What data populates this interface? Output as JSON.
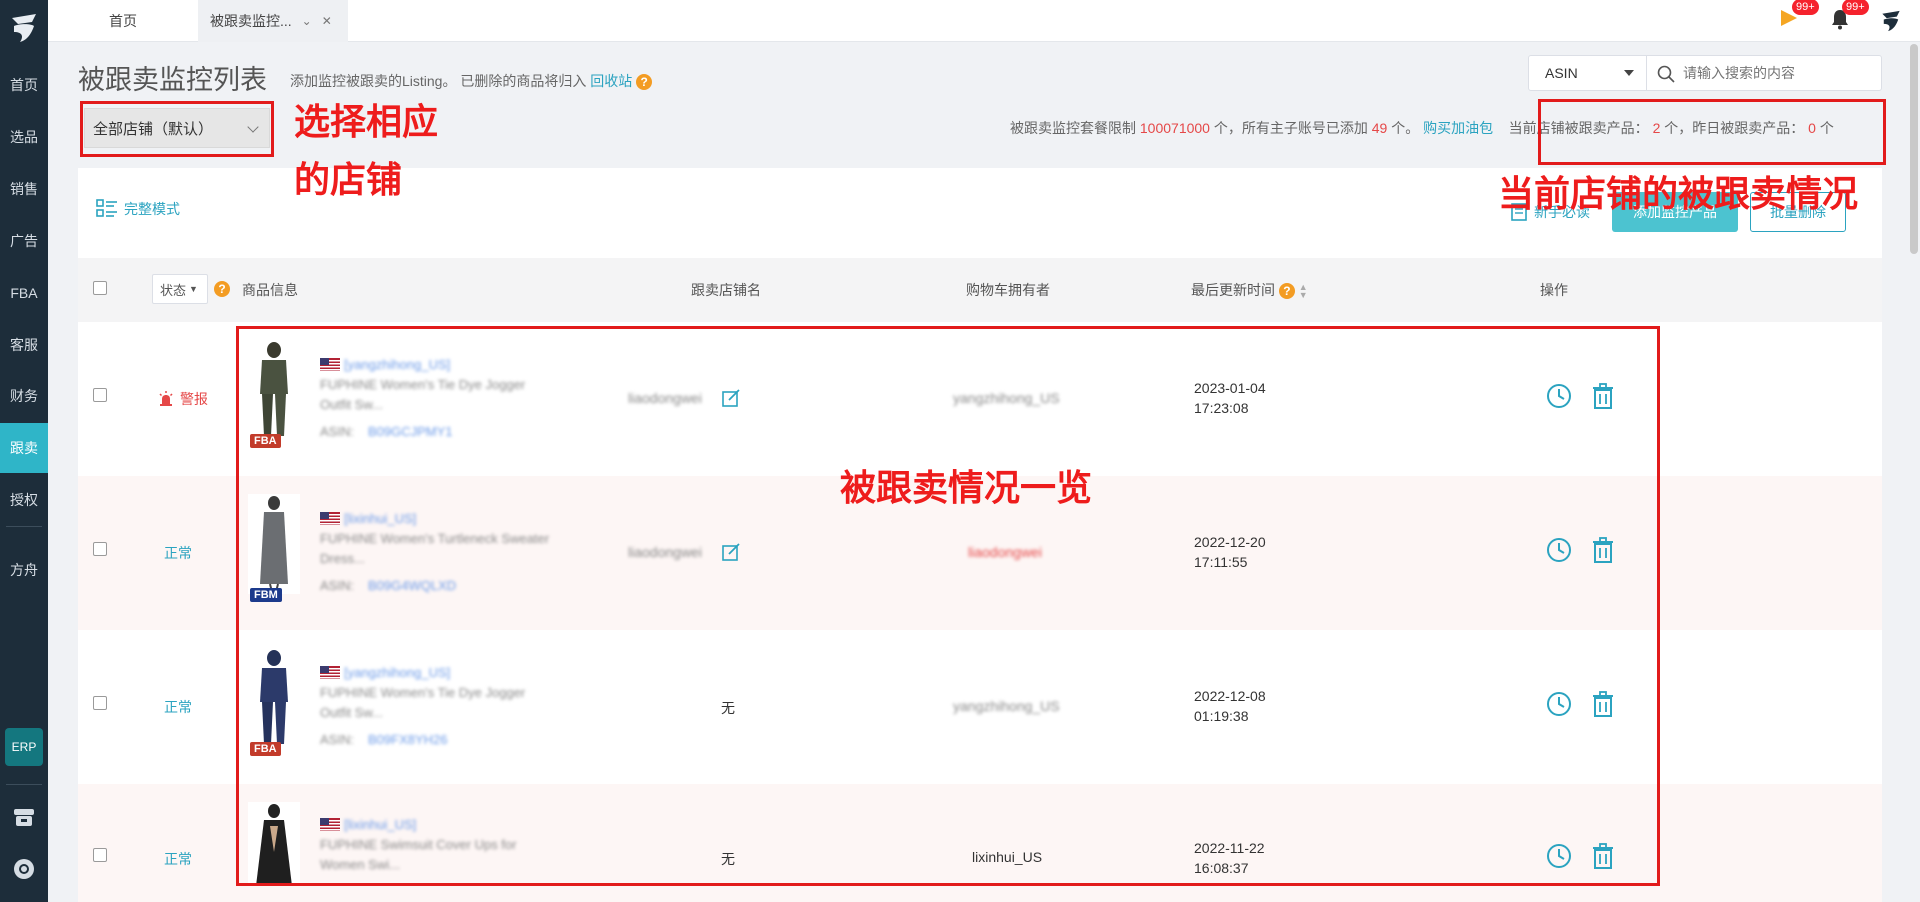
{
  "sidebar": {
    "items": [
      {
        "label": "首页"
      },
      {
        "label": "选品"
      },
      {
        "label": "销售"
      },
      {
        "label": "广告"
      },
      {
        "label": "FBA"
      },
      {
        "label": "客服"
      },
      {
        "label": "财务"
      },
      {
        "label": "跟卖"
      },
      {
        "label": "授权"
      },
      {
        "label": "方舟"
      }
    ],
    "erp_label": "ERP",
    "active_color": "#2fb5c8"
  },
  "topbar": {
    "tab_home": "首页",
    "tab_active": "被跟卖监控...",
    "badge_flag": "99+",
    "badge_bell": "99+"
  },
  "header": {
    "title": "被跟卖监控列表",
    "subtitle": "添加监控被跟卖的Listing。 已删除的商品将归入",
    "recycle_link": "回收站",
    "search_type": "ASIN",
    "search_placeholder": "请输入搜索的内容",
    "store_select": "全部店铺（默认）",
    "quota_prefix": "被跟卖监控套餐限制",
    "quota_limit": "100071000",
    "quota_mid": "个，所有主子账号已添加",
    "quota_added": "49",
    "quota_suffix": "个。",
    "buy_link": "购买加油包",
    "current_label": "当前店铺被跟卖产品：",
    "current_count": "2",
    "yesterday_label": "个，昨日被跟卖产品：",
    "yesterday_count": "0",
    "unit": "个"
  },
  "toolbar": {
    "mode": "完整模式",
    "guide": "新手必读",
    "add": "添加监控产品",
    "batch_delete": "批量删除"
  },
  "table": {
    "headers": {
      "status": "状态",
      "product": "商品信息",
      "seller": "跟卖店铺名",
      "buybox": "购物车拥有者",
      "updated": "最后更新时间",
      "actions": "操作"
    },
    "rows": [
      {
        "status": "警报",
        "account": "[yangzhihong_US]",
        "title1": "FUPHINE Women's Tie Dye Jogger",
        "title2": "Outfit Sw...",
        "asin_label": "ASIN:",
        "asin": "B09GCJPMY1",
        "fulfill": "FBA",
        "seller": "liaodongwei",
        "buybox": "yangzhihong_US",
        "date": "2023-01-04",
        "time": "17:23:08"
      },
      {
        "status": "正常",
        "account": "[lixinhui_US]",
        "title1": "FUPHINE Women's Turtleneck Sweater",
        "title2": "Dress...",
        "asin_label": "ASIN:",
        "asin": "B09G4WQLXD",
        "fulfill": "FBM",
        "seller": "liaodongwei",
        "buybox": "liaodongwei",
        "date": "2022-12-20",
        "time": "17:11:55"
      },
      {
        "status": "正常",
        "account": "[yangzhihong_US]",
        "title1": "FUPHINE Women's Tie Dye Jogger",
        "title2": "Outfit Sw...",
        "asin_label": "ASIN:",
        "asin": "B09FX8YH26",
        "fulfill": "FBA",
        "seller": "无",
        "buybox": "yangzhihong_US",
        "date": "2022-12-08",
        "time": "01:19:38"
      },
      {
        "status": "正常",
        "account": "[lixinhui_US]",
        "title1": "FUPHINE Swimsuit Cover Ups for",
        "title2": "Women Swi...",
        "asin_label": "",
        "asin": "",
        "fulfill": "",
        "seller": "无",
        "buybox": "lixinhui_US",
        "date": "2022-11-22",
        "time": "16:08:37"
      }
    ]
  },
  "annotations": {
    "store_l1": "选择相应",
    "store_l2": "的店铺",
    "status": "当前店铺的被跟卖情况",
    "overview": "被跟卖情况一览"
  }
}
